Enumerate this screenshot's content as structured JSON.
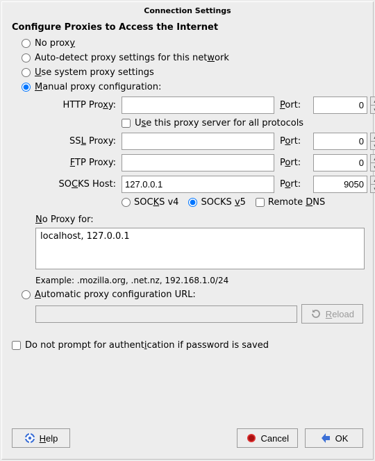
{
  "title": "Connection Settings",
  "heading": "Configure Proxies to Access the Internet",
  "radios": {
    "no_proxy_pre": "No prox",
    "no_proxy_u": "y",
    "auto_pre": "Auto-detect proxy settings for this net",
    "auto_u": "w",
    "auto_post": "ork",
    "system_u": "U",
    "system_post": "se system proxy settings",
    "manual_u": "M",
    "manual_post": "anual proxy configuration:"
  },
  "labels": {
    "http_pre": "HTTP Pro",
    "http_u": "x",
    "http_post": "y:",
    "use_all_pre": "U",
    "use_all_u": "s",
    "use_all_post": "e this proxy server for all protocols",
    "ssl_pre": "SS",
    "ssl_u": "L",
    "ssl_post": " Proxy:",
    "ftp_u": "F",
    "ftp_post": "TP Proxy:",
    "socks_pre": "SO",
    "socks_u": "C",
    "socks_post": "KS Host:",
    "port_pre": "P",
    "port_u": "o",
    "port_post": "rt:",
    "port2_pre": "P",
    "port2_u": "o",
    "port2_post": "rt:",
    "sv4_pre": "SOC",
    "sv4_u": "K",
    "sv4_post": "S v4",
    "sv5_pre": "SOCKS ",
    "sv5_u": "v",
    "sv5_post": "5",
    "remote_pre": "Remote ",
    "remote_u": "D",
    "remote_post": "NS",
    "noproxy_pre": "N",
    "noproxy_u": "o",
    "noproxy_post": " Proxy for:",
    "pac_pre": "A",
    "pac_u": "u",
    "pac_post": "tomatic proxy configuration URL:",
    "auth_pre": "Do not prompt for authent",
    "auth_u": "i",
    "auth_post": "cation if password is saved",
    "reload_u": "R",
    "reload_post": "eload",
    "help_u": "H",
    "help_post": "elp",
    "cancel": "Cancel",
    "ok": "OK"
  },
  "values": {
    "http_proxy": "",
    "http_port": "0",
    "ssl_proxy": "",
    "ssl_port": "0",
    "ftp_proxy": "",
    "ftp_port": "0",
    "socks_host": "127.0.0.1",
    "socks_port": "9050",
    "no_proxy": "localhost, 127.0.0.1",
    "pac_url": ""
  },
  "example": "Example: .mozilla.org, .net.nz, 192.168.1.0/24",
  "state": {
    "selected_mode": "manual",
    "use_all": false,
    "socks_version": "v5",
    "remote_dns": false,
    "auth_noprompt": false
  }
}
